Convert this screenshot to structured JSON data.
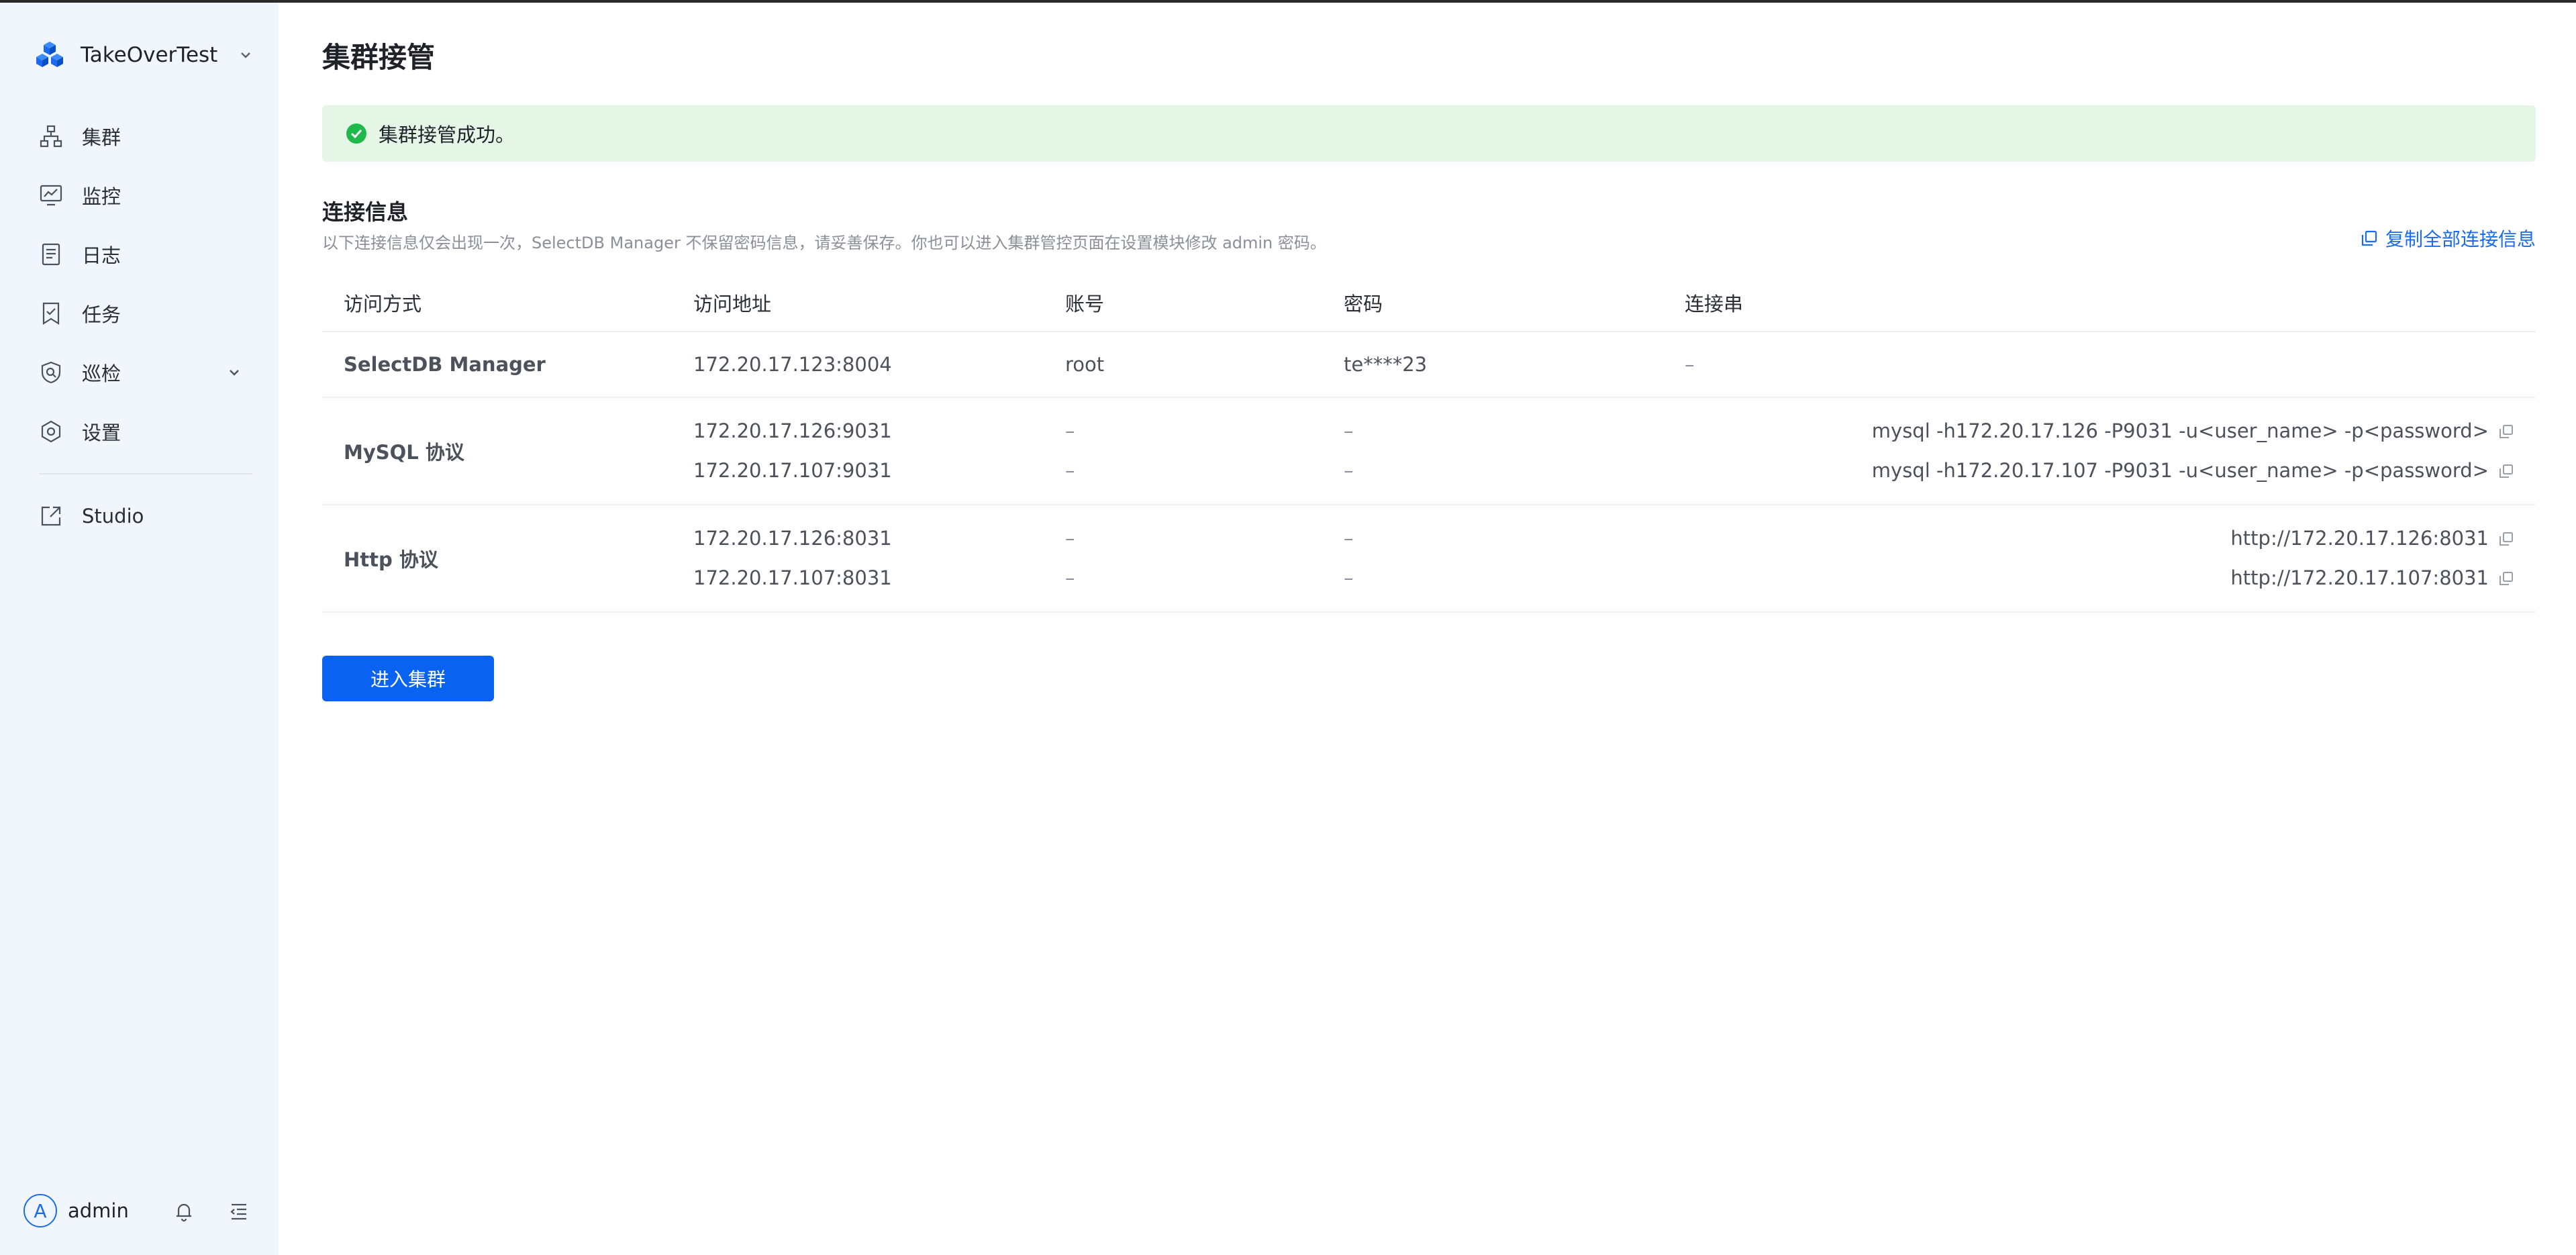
{
  "brand": {
    "name": "TakeOverTest"
  },
  "sidebar": {
    "items": [
      {
        "label": "集群",
        "icon": "cluster-icon"
      },
      {
        "label": "监控",
        "icon": "monitor-icon"
      },
      {
        "label": "日志",
        "icon": "log-icon"
      },
      {
        "label": "任务",
        "icon": "task-icon"
      },
      {
        "label": "巡检",
        "icon": "inspection-icon"
      },
      {
        "label": "设置",
        "icon": "gear-icon"
      },
      {
        "label": "Studio",
        "icon": "external-link-icon"
      }
    ],
    "user": {
      "avatar_letter": "A",
      "name": "admin"
    }
  },
  "page": {
    "title": "集群接管",
    "alert": "集群接管成功。",
    "section_title": "连接信息",
    "section_desc": "以下连接信息仅会出现一次，SelectDB Manager 不保留密码信息，请妥善保存。你也可以进入集群管控页面在设置模块修改 admin 密码。",
    "copy_all_label": "复制全部连接信息",
    "enter_button": "进入集群"
  },
  "table": {
    "headers": [
      "访问方式",
      "访问地址",
      "账号",
      "密码",
      "连接串"
    ],
    "selectdb": {
      "method": "SelectDB Manager",
      "address": "172.20.17.123:8004",
      "account": "root",
      "password": "te****23",
      "conn": "–"
    },
    "mysql": {
      "method": "MySQL 协议",
      "rows": [
        {
          "address": "172.20.17.126:9031",
          "account": "–",
          "password": "–",
          "conn": "mysql -h172.20.17.126 -P9031 -u<user_name> -p<password>"
        },
        {
          "address": "172.20.17.107:9031",
          "account": "–",
          "password": "–",
          "conn": "mysql -h172.20.17.107 -P9031 -u<user_name> -p<password>"
        }
      ]
    },
    "http": {
      "method": "Http 协议",
      "rows": [
        {
          "address": "172.20.17.126:8031",
          "account": "–",
          "password": "–",
          "conn": "http://172.20.17.126:8031"
        },
        {
          "address": "172.20.17.107:8031",
          "account": "–",
          "password": "–",
          "conn": "http://172.20.17.107:8031"
        }
      ]
    }
  },
  "colors": {
    "accent": "#0a63f0",
    "sidebar_bg": "#f1f6fc",
    "success_bg": "#e6f6e6",
    "success": "#1fb84a"
  }
}
